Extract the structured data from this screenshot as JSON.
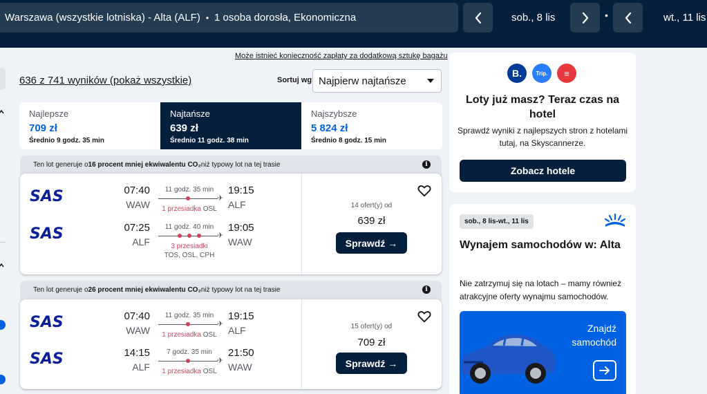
{
  "header": {
    "route": "Warszawa (wszystkie lotniska) - Alta (ALF)",
    "separator": "•",
    "passengers": "1 osoba dorosła, Ekonomiczna",
    "depart_date": "sob., 8 lis",
    "return_date": "wt., 11 lis"
  },
  "bag_note": "Może istnieć konieczność zapłaty za dodatkową sztukę bagażu",
  "results_count": "636 z 741 wyników (pokaż wszystkie)",
  "sort": {
    "label": "Sortuj wg",
    "value": "Najpierw najtańsze"
  },
  "tabs": [
    {
      "name": "Najlepsze",
      "price": "709 zł",
      "duration": "Średnio 9 godz. 35 min"
    },
    {
      "name": "Najtańsze",
      "price": "639 zł",
      "duration": "Średnio 11 godz. 38 min"
    },
    {
      "name": "Najszybsze",
      "price": "5 824 zł",
      "duration": "Średnio 8 godz. 15 min"
    }
  ],
  "results": [
    {
      "eco_pre": "Ten lot generuje o ",
      "eco_bold": "16 procent mniej ekwiwalentu CO₂",
      "eco_post": " niż typowy lot na tej trasie",
      "airline": "SAS",
      "legs": [
        {
          "dep_time": "07:40",
          "dep_code": "WAW",
          "arr_time": "19:15",
          "arr_code": "ALF",
          "duration": "11 godz. 35 min",
          "stops": "1 przesiadka",
          "via": "OSL"
        },
        {
          "dep_time": "07:25",
          "dep_code": "ALF",
          "arr_time": "19:05",
          "arr_code": "WAW",
          "duration": "11 godz. 40 min",
          "stops": "3 przesiadki",
          "via": "TOS, OSL, CPH"
        }
      ],
      "offers": "14 ofert(y) od",
      "price": "639 zł",
      "button": "Sprawdź →"
    },
    {
      "eco_pre": "Ten lot generuje o ",
      "eco_bold": "26 procent mniej ekwiwalentu CO₂",
      "eco_post": " niż typowy lot na tej trasie",
      "airline": "SAS",
      "legs": [
        {
          "dep_time": "07:40",
          "dep_code": "WAW",
          "arr_time": "19:15",
          "arr_code": "ALF",
          "duration": "11 godz. 35 min",
          "stops": "1 przesiadka",
          "via": "OSL"
        },
        {
          "dep_time": "14:15",
          "dep_code": "ALF",
          "arr_time": "21:50",
          "arr_code": "WAW",
          "duration": "7 godz. 35 min",
          "stops": "1 przesiadka",
          "via": "OSL"
        }
      ],
      "offers": "15 ofert(y) od",
      "price": "709 zł",
      "button": "Sprawdź →"
    }
  ],
  "hotel": {
    "logos": [
      "B.",
      "Trip.",
      "≡"
    ],
    "title": "Loty już masz? Teraz czas na hotel",
    "text": "Sprawdź wyniki z najlepszych stron z hotelami tutaj, na Skyscannerze.",
    "button": "Zobacz hotele"
  },
  "car": {
    "badge": "sob., 8 lis-wt., 11 lis",
    "title": "Wynajem samochodów w: Alta",
    "text": "Nie zatrzymuj się na lotach – mamy również atrakcyjne oferty wynajmu samochodów.",
    "cta": "Znajdź samochód"
  },
  "colors": {
    "navy": "#05203c",
    "blue": "#0062e3",
    "stop_red": "#d1435b"
  }
}
